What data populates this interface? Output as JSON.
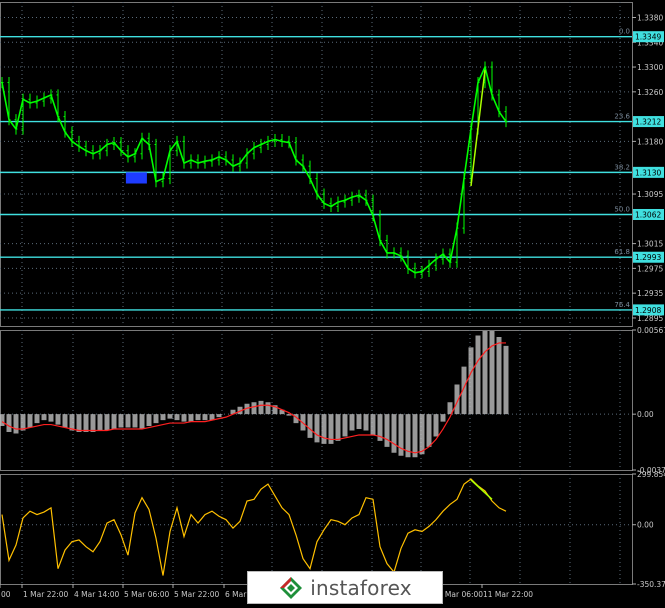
{
  "colors": {
    "background": "#000000",
    "grid": "#5b6b7a",
    "price": "#00ff00",
    "level": "#40e0e0",
    "fib_text": "#7a8a9a",
    "axis_text": "#c8c8c8",
    "macd_hist": "#c0c0c0",
    "macd_signal": "#ff2020",
    "cci": "#ffc000",
    "trendline": "#aaff00",
    "zone": "#1e3cff"
  },
  "chart_data": [
    {
      "type": "line",
      "panel": "price",
      "ylim": [
        1.2882,
        1.3405
      ],
      "yticks": [
        "1.3380",
        "1.3340",
        "1.3300",
        "1.3260",
        "1.3180",
        "1.3095",
        "1.3015",
        "1.2975",
        "1.2935",
        "1.2895"
      ],
      "levels": [
        {
          "fib": "0.0",
          "value": "1.3349"
        },
        {
          "fib": "23.6",
          "value": "1.3212"
        },
        {
          "fib": "38.2",
          "value": "1.3130"
        },
        {
          "fib": "50.0",
          "value": "1.3062"
        },
        {
          "fib": "61.8",
          "value": "1.2993"
        },
        {
          "fib": "76.4",
          "value": "1.2908"
        }
      ],
      "series": [
        {
          "values": [
            1.3275,
            1.3215,
            1.32,
            1.3248,
            1.3242,
            1.3245,
            1.325,
            1.3255,
            1.322,
            1.3195,
            1.318,
            1.3172,
            1.3165,
            1.316,
            1.3165,
            1.3175,
            1.3178,
            1.3165,
            1.3155,
            1.316,
            1.3185,
            1.3175,
            1.3115,
            1.312,
            1.3165,
            1.318,
            1.3145,
            1.315,
            1.3145,
            1.3148,
            1.315,
            1.3155,
            1.315,
            1.314,
            1.3145,
            1.316,
            1.317,
            1.3175,
            1.318,
            1.3183,
            1.318,
            1.3178,
            1.315,
            1.314,
            1.312,
            1.3095,
            1.308,
            1.3075,
            1.3082,
            1.3085,
            1.309,
            1.3093,
            1.3085,
            1.306,
            1.302,
            1.3,
            1.3,
            1.2995,
            1.2975,
            1.2968,
            1.297,
            1.298,
            1.299,
            1.2998,
            1.2985,
            1.304,
            1.312,
            1.32,
            1.3275,
            1.33,
            1.3255,
            1.3228,
            1.3212
          ]
        }
      ],
      "trendline": {
        "from": [
          67,
          1.3108
        ],
        "to": [
          69,
          1.3295
        ]
      },
      "zone": {
        "from": 17.7,
        "to": 20.7,
        "low": 1.3112,
        "high": 1.313
      }
    },
    {
      "type": "bar",
      "panel": "macd",
      "ylim": [
        -0.00376,
        0.00567
      ],
      "yticks": [
        "0.00567",
        "0.00",
        "-0.00376"
      ],
      "series": [
        {
          "name": "histogram",
          "values": [
            -0.0008,
            -0.0012,
            -0.0013,
            -0.0011,
            -0.0009,
            -0.0006,
            -0.0004,
            -0.0005,
            -0.0007,
            -0.0009,
            -0.0011,
            -0.0012,
            -0.0012,
            -0.0012,
            -0.0011,
            -0.0011,
            -0.001,
            -0.0009,
            -0.0009,
            -0.0009,
            -0.001,
            -0.0008,
            -0.0006,
            -0.0004,
            -0.0003,
            -0.0004,
            -0.0005,
            -0.0005,
            -0.0004,
            -0.0004,
            -0.0004,
            -0.0002,
            0.0,
            0.0003,
            0.0005,
            0.0007,
            0.0008,
            0.0009,
            0.0008,
            0.0006,
            0.0003,
            -0.0001,
            -0.0006,
            -0.0011,
            -0.0016,
            -0.0019,
            -0.002,
            -0.002,
            -0.0018,
            -0.0015,
            -0.0011,
            -0.001,
            -0.0011,
            -0.0014,
            -0.0018,
            -0.0022,
            -0.0026,
            -0.0028,
            -0.0029,
            -0.0029,
            -0.0027,
            -0.0022,
            -0.0015,
            -0.0005,
            0.0008,
            0.002,
            0.0032,
            0.0045,
            0.0053,
            0.0056,
            0.0056,
            0.0052,
            0.0046
          ]
        },
        {
          "name": "signal",
          "values": [
            -0.0005,
            -0.0008,
            -0.001,
            -0.001,
            -0.0009,
            -0.0008,
            -0.0007,
            -0.0007,
            -0.0008,
            -0.0009,
            -0.001,
            -0.0011,
            -0.0011,
            -0.0011,
            -0.0011,
            -0.0011,
            -0.001,
            -0.001,
            -0.001,
            -0.001,
            -0.001,
            -0.0009,
            -0.0008,
            -0.0007,
            -0.0006,
            -0.0006,
            -0.0006,
            -0.0005,
            -0.0005,
            -0.0005,
            -0.0004,
            -0.0003,
            -0.0002,
            0.0,
            0.0002,
            0.0004,
            0.0005,
            0.0006,
            0.0006,
            0.0005,
            0.0003,
            0.0001,
            -0.0002,
            -0.0006,
            -0.001,
            -0.0014,
            -0.0016,
            -0.0017,
            -0.0017,
            -0.0016,
            -0.0015,
            -0.0014,
            -0.0014,
            -0.0014,
            -0.0015,
            -0.0017,
            -0.002,
            -0.0023,
            -0.0025,
            -0.0026,
            -0.0025,
            -0.0022,
            -0.0017,
            -0.001,
            -0.0002,
            0.0008,
            0.0018,
            0.0028,
            0.0036,
            0.0042,
            0.0046,
            0.0048,
            0.0048
          ]
        }
      ]
    },
    {
      "type": "line",
      "panel": "cci",
      "ylim": [
        -350.373,
        299.8547
      ],
      "yticks": [
        "299.8547",
        "0.00",
        "-350.373"
      ],
      "series": [
        {
          "values": [
            60,
            -210,
            -120,
            40,
            80,
            60,
            75,
            100,
            -260,
            -150,
            -100,
            -90,
            -130,
            -160,
            -100,
            10,
            30,
            -60,
            -180,
            70,
            160,
            90,
            -80,
            -300,
            -40,
            100,
            -70,
            60,
            10,
            60,
            80,
            50,
            30,
            -20,
            20,
            140,
            150,
            210,
            240,
            170,
            100,
            60,
            -60,
            -200,
            -260,
            -100,
            -30,
            30,
            20,
            0,
            40,
            60,
            160,
            150,
            -130,
            -230,
            -280,
            -140,
            -50,
            -30,
            -40,
            -10,
            30,
            80,
            120,
            150,
            240,
            270,
            230,
            200,
            140,
            100,
            80
          ]
        }
      ],
      "trendline": {
        "from": [
          67,
          265
        ],
        "to": [
          70,
          150
        ]
      }
    }
  ],
  "x_labels": [
    "00",
    "1 Mar 22:00",
    "4 Mar 14:00",
    "5 Mar 06:00",
    "5 Mar 22:00",
    "6 Mar",
    "11 Mar 06:00",
    "11 Mar 22:00"
  ],
  "watermark": {
    "text": "instaforex"
  }
}
